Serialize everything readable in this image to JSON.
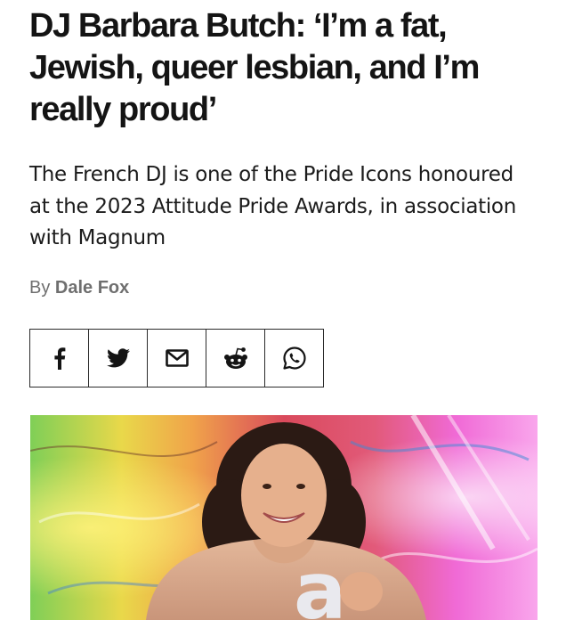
{
  "article": {
    "headline": "DJ Barbara Butch: ‘I’m a fat, Jewish, queer lesbian, and I’m really proud’",
    "standfirst": "The French DJ is one of the Pride Icons honoured at the 2023 Attitude Pride Awards, in association with Magnum",
    "byline": {
      "prefix": "By",
      "author": "Dale Fox"
    }
  },
  "share": {
    "buttons": [
      {
        "network": "facebook",
        "icon": "facebook-icon"
      },
      {
        "network": "twitter",
        "icon": "twitter-icon"
      },
      {
        "network": "email",
        "icon": "email-icon"
      },
      {
        "network": "reddit",
        "icon": "reddit-icon"
      },
      {
        "network": "whatsapp",
        "icon": "whatsapp-icon"
      }
    ]
  },
  "hero_image": {
    "subject": "portrait-photo",
    "letter_trophy": "a"
  },
  "colors": {
    "text": "#141414",
    "byline": "#6f6f6f",
    "border": "#2a2a2a"
  }
}
